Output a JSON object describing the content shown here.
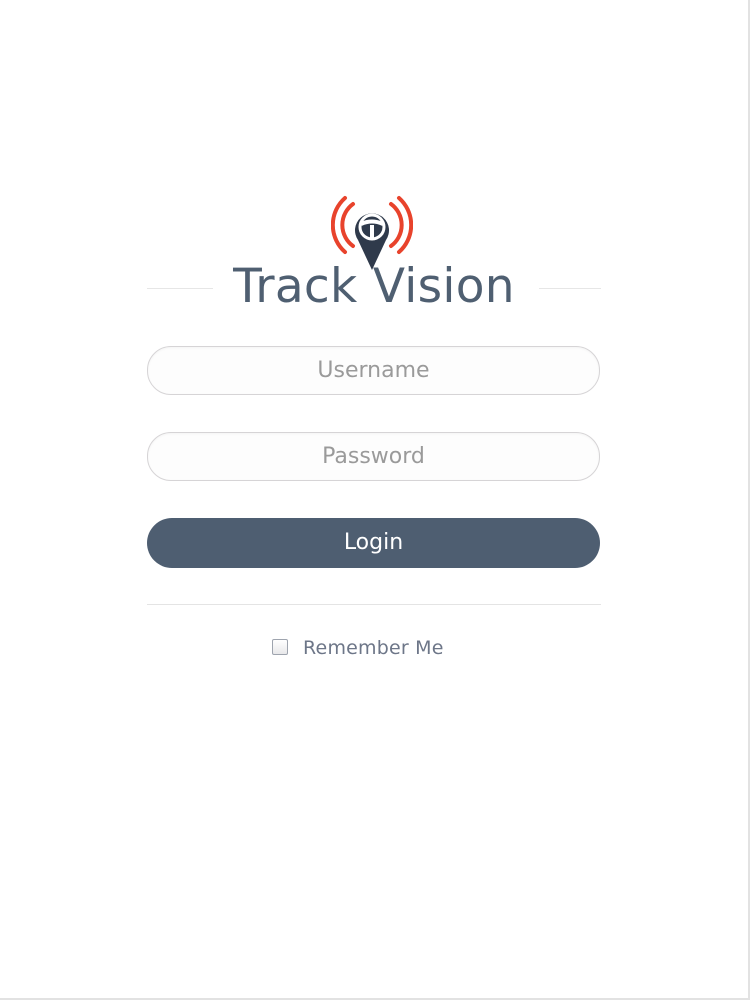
{
  "brand": {
    "name": "Track Vision",
    "icon": "map-pin-steering-wheel-signal-icon",
    "colors": {
      "primary": "#4e5e71",
      "signal": "#e8432c",
      "pin": "#2f3a4b"
    }
  },
  "form": {
    "username_placeholder": "Username",
    "password_placeholder": "Password",
    "login_label": "Login",
    "remember_label": "Remember Me",
    "remember_checked": false
  }
}
